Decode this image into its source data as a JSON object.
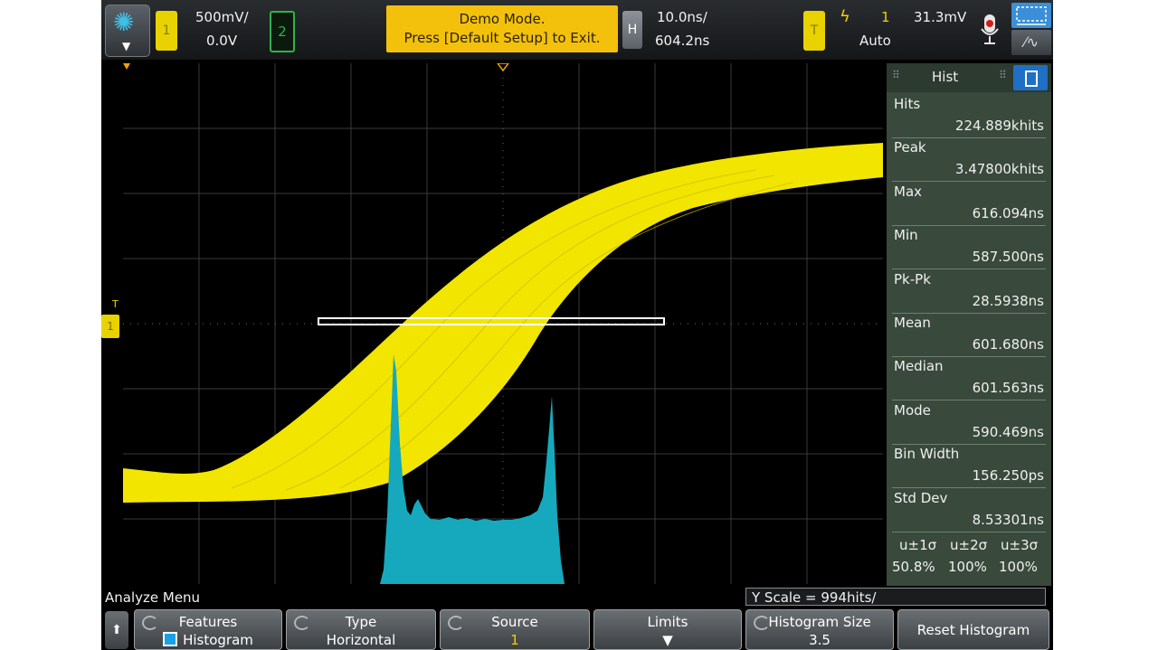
{
  "topbar": {
    "ch1_label": "1",
    "ch1_scale": "500mV/",
    "ch1_offset": "0.0V",
    "ch2_label": "2",
    "demo_line1": "Demo Mode.",
    "demo_line2": "Press [Default Setup] to Exit.",
    "h_label": "H",
    "time_scale": "10.0ns/",
    "time_delay": "604.2ns",
    "trig_label": "T",
    "trig_source": "1",
    "trig_level": "31.3mV",
    "trig_mode": "Auto"
  },
  "screen": {
    "ch1_marker": "1",
    "trig_marker": "T"
  },
  "panel": {
    "title": "Hist",
    "stats": [
      {
        "label": "Hits",
        "value": "224.889khits"
      },
      {
        "label": "Peak",
        "value": "3.47800khits"
      },
      {
        "label": "Max",
        "value": "616.094ns"
      },
      {
        "label": "Min",
        "value": "587.500ns"
      },
      {
        "label": "Pk-Pk",
        "value": "28.5938ns"
      },
      {
        "label": "Mean",
        "value": "601.680ns"
      },
      {
        "label": "Median",
        "value": "601.563ns"
      },
      {
        "label": "Mode",
        "value": "590.469ns"
      },
      {
        "label": "Bin Width",
        "value": "156.250ps"
      },
      {
        "label": "Std Dev",
        "value": "8.53301ns"
      }
    ],
    "sigma_headers": [
      "u±1σ",
      "u±2σ",
      "u±3σ"
    ],
    "sigma_values": [
      "50.8%",
      "100%",
      "100%"
    ]
  },
  "menu": {
    "title": "Analyze Menu",
    "yscale": "Y Scale = 994hits/",
    "softkeys": [
      {
        "top": "Features",
        "bottom": "Histogram"
      },
      {
        "top": "Type",
        "bottom": "Horizontal"
      },
      {
        "top": "Source",
        "bottom": "1"
      },
      {
        "top": "Limits",
        "bottom": ""
      },
      {
        "top": "Histogram Size",
        "bottom": "3.5"
      },
      {
        "top": "Reset Histogram",
        "bottom": ""
      }
    ]
  },
  "colors": {
    "ch1": "#f2e600",
    "histogram": "#16a9bd",
    "accent": "#3a8fd8"
  }
}
